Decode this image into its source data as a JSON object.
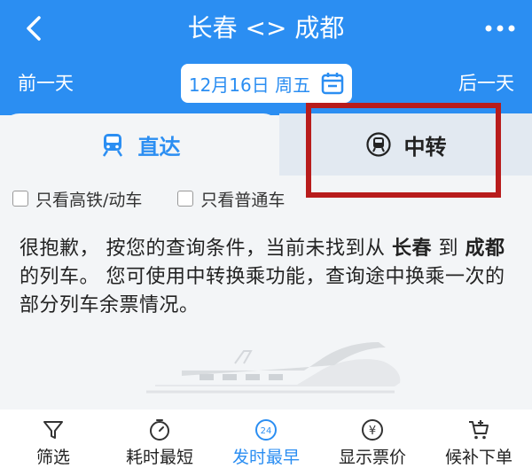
{
  "header": {
    "title": "长春 <> 成都",
    "prev_day": "前一天",
    "next_day": "后一天",
    "date": "12月16日 周五"
  },
  "tabs": {
    "direct": "直达",
    "transfer": "中转"
  },
  "filters": {
    "high_speed": "只看高铁/动车",
    "normal": "只看普通车"
  },
  "message": {
    "part1": "很抱歉， 按您的查询条件，当前未找到从 ",
    "from": "长春",
    "part2": " 到 ",
    "to": "成都",
    "part3": " 的列车。 您可使用中转换乘功能，查询途中换乘一次的部分列车余票情况。"
  },
  "bottom_bar": {
    "filter": "筛选",
    "shortest": "耗时最短",
    "earliest": "发时最早",
    "earliest_badge": "24",
    "show_price": "显示票价",
    "waitlist": "候补下单",
    "price_symbol": "¥"
  },
  "colors": {
    "primary": "#2b8ef2",
    "highlight": "#b81c1c"
  },
  "icons": [
    "back-icon",
    "more-icon",
    "calendar-icon",
    "train-icon",
    "transfer-icon",
    "filter-icon",
    "timer-icon",
    "clock-24-icon",
    "yen-icon",
    "cart-icon"
  ]
}
